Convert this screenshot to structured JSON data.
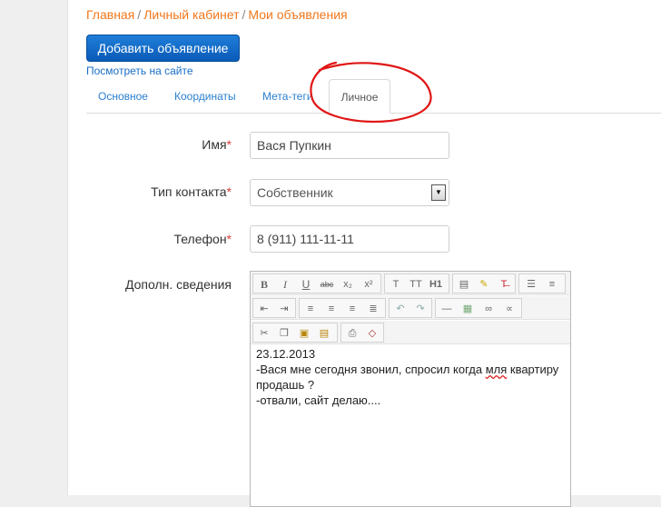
{
  "breadcrumb": {
    "home": "Главная",
    "cabinet": "Личный кабинет",
    "ads": "Мои объявления",
    "sep": "/"
  },
  "actions": {
    "add_ad": "Добавить объявление",
    "view_on_site": "Посмотреть на сайте"
  },
  "tabs": [
    {
      "label": "Основное"
    },
    {
      "label": "Координаты"
    },
    {
      "label": "Мета-теги"
    },
    {
      "label": "Личное",
      "active": true
    }
  ],
  "form": {
    "name_label": "Имя",
    "name_value": "Вася Пупкин",
    "contact_type_label": "Тип контакта",
    "contact_type_value": "Собственник",
    "phone_label": "Телефон",
    "phone_value": "8 (911) 111-11-11",
    "extra_label": "Дополн. сведения",
    "required_mark": "*"
  },
  "editor": {
    "line1": "23.12.2013",
    "line2_a": "-Вася мне сегодня звонил, спросил когда ",
    "line2_b": "мля",
    "line2_c": " квартиру",
    "line3": "продашь ?",
    "line4": "-отвали, сайт делаю....",
    "toolbar_row1": [
      "B",
      "I",
      "U",
      "abc",
      "x₂",
      "x²",
      "T",
      "TT",
      "H1"
    ],
    "icons": [
      "bold-icon",
      "italic-icon",
      "underline-icon",
      "strike-icon",
      "subscript-icon",
      "superscript-icon",
      "font-icon",
      "font-size-icon",
      "heading-icon",
      "color-icon",
      "highlight-icon",
      "clear-format-icon",
      "bullet-list-icon",
      "numbered-list-icon",
      "outdent-icon",
      "indent-icon",
      "align-left-icon",
      "align-center-icon",
      "align-right-icon",
      "align-justify-icon",
      "undo-icon",
      "redo-icon",
      "hr-icon",
      "table-icon",
      "link-icon",
      "unlink-icon",
      "cut-icon",
      "copy-icon",
      "paste-icon",
      "paste-text-icon",
      "print-icon",
      "source-icon"
    ]
  },
  "colors": {
    "breadcrumb_link": "#f0771c",
    "tab_link": "#2a7fd0",
    "button_bg": "#0a5bb8",
    "required": "#d43f3a",
    "annotation": "#e01515"
  }
}
